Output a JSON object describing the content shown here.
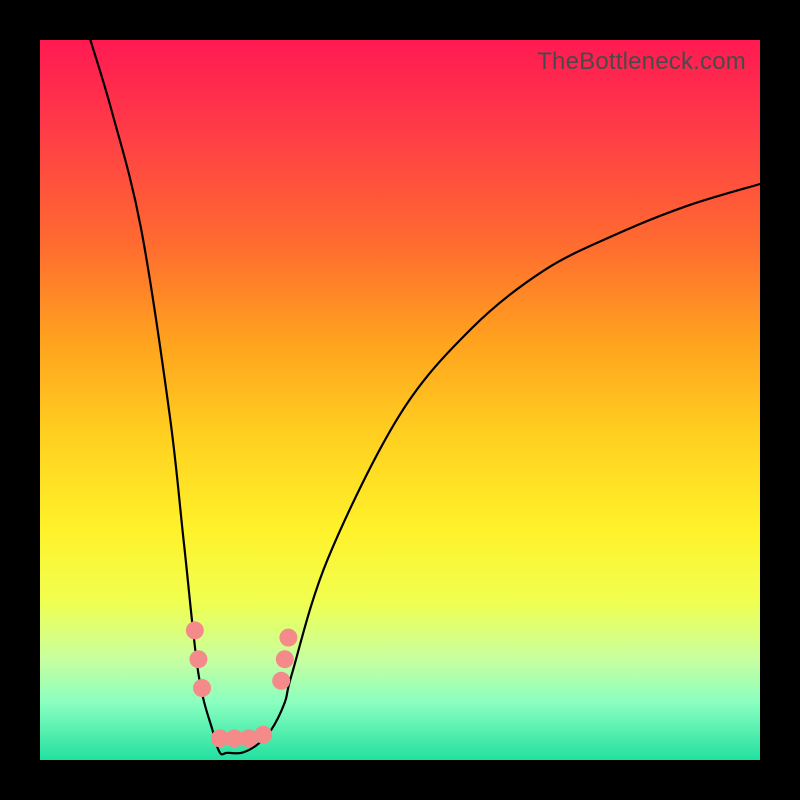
{
  "watermark": "TheBottleneck.com",
  "chart_data": {
    "type": "line",
    "title": "",
    "xlabel": "",
    "ylabel": "",
    "xlim": [
      0,
      100
    ],
    "ylim": [
      0,
      100
    ],
    "series": [
      {
        "name": "bottleneck-curve",
        "x": [
          7,
          10,
          14,
          18,
          20,
          22,
          24,
          25,
          26,
          28,
          30,
          32,
          34,
          35,
          40,
          50,
          60,
          70,
          80,
          90,
          100
        ],
        "y": [
          100,
          90,
          74,
          48,
          30,
          12,
          4,
          1,
          1,
          1,
          2,
          4,
          8,
          12,
          28,
          48,
          60,
          68,
          73,
          77,
          80
        ]
      }
    ],
    "markers": {
      "name": "highlighted-points",
      "color": "#f48a8a",
      "points": [
        {
          "x": 21.5,
          "y": 18
        },
        {
          "x": 22.0,
          "y": 14
        },
        {
          "x": 22.5,
          "y": 10
        },
        {
          "x": 25.0,
          "y": 3
        },
        {
          "x": 27.0,
          "y": 3
        },
        {
          "x": 29.0,
          "y": 3
        },
        {
          "x": 31.0,
          "y": 3.5
        },
        {
          "x": 33.5,
          "y": 11
        },
        {
          "x": 34.0,
          "y": 14
        },
        {
          "x": 34.5,
          "y": 17
        }
      ]
    },
    "annotations": []
  }
}
